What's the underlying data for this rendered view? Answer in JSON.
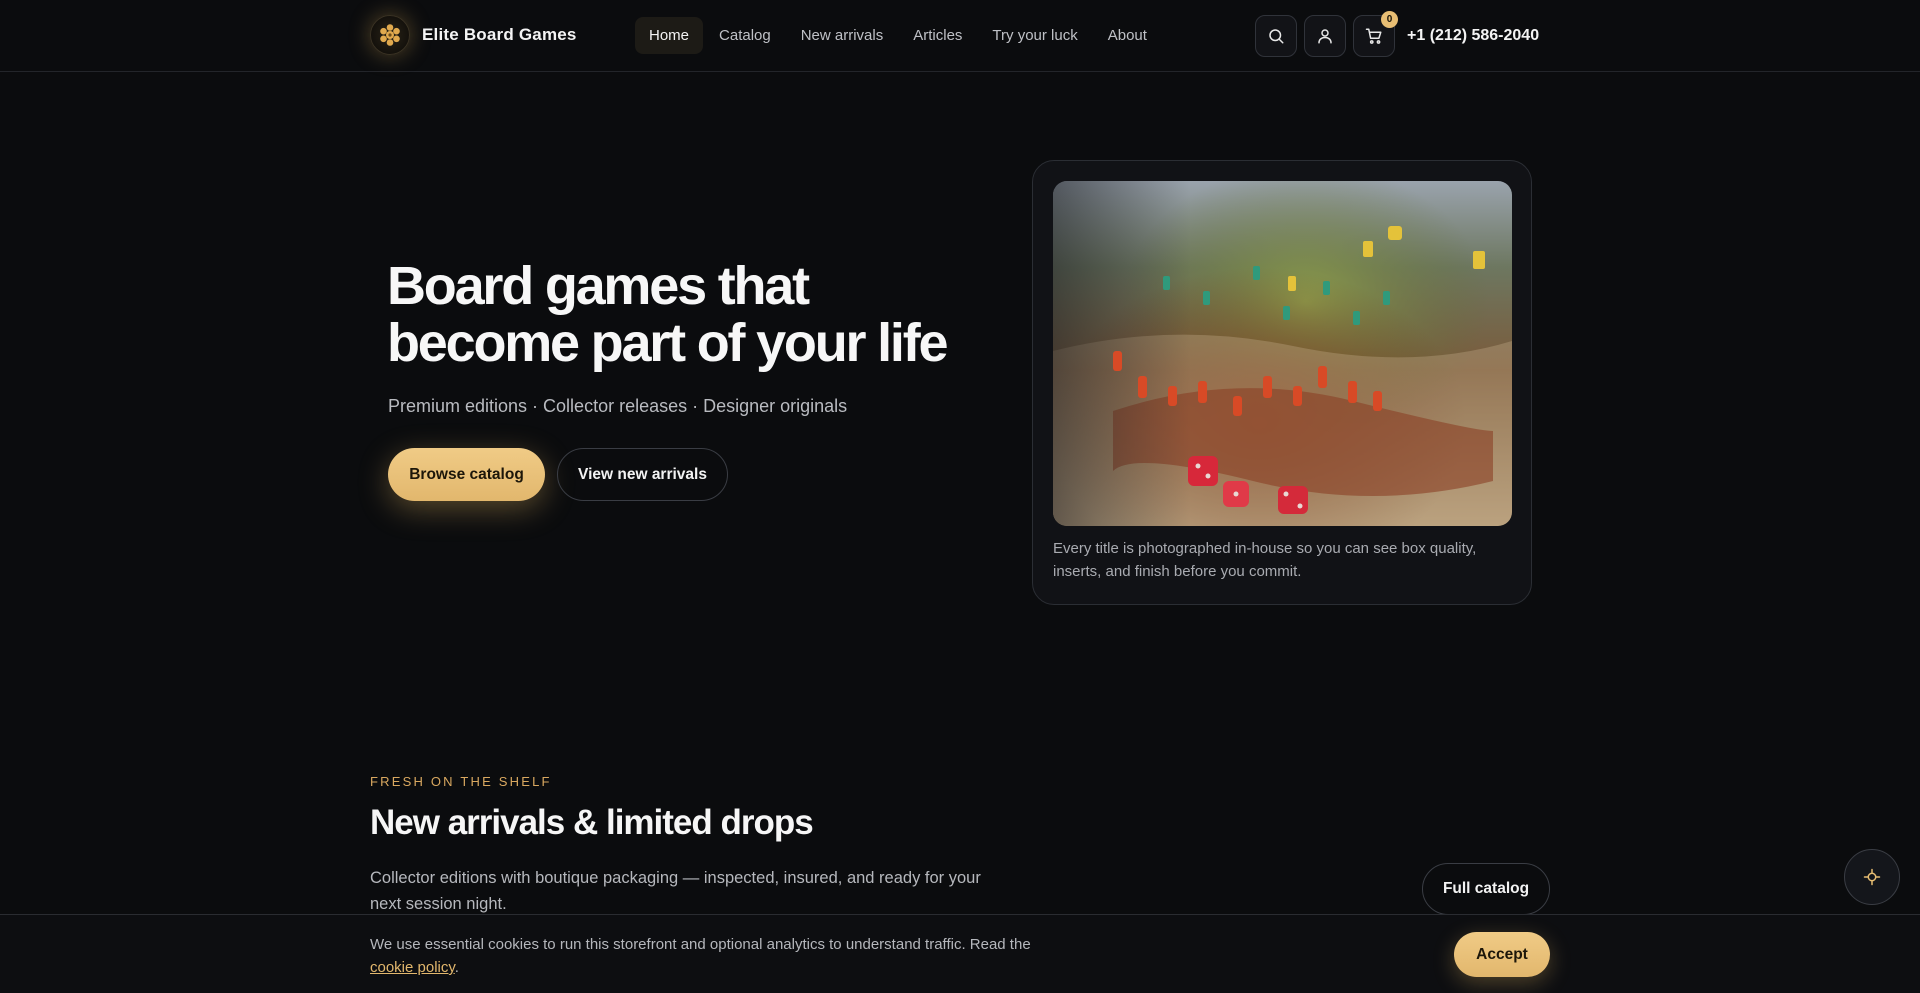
{
  "header": {
    "brand_name": "Elite Board Games",
    "nav": [
      {
        "label": "Home",
        "active": true
      },
      {
        "label": "Catalog"
      },
      {
        "label": "New arrivals"
      },
      {
        "label": "Articles"
      },
      {
        "label": "Try your luck"
      },
      {
        "label": "About"
      }
    ],
    "icons": [
      "search-icon",
      "user-icon",
      "cart-icon"
    ],
    "cart_count": "0",
    "phone": "+1 (212) 586-2040"
  },
  "hero": {
    "title": "Board games that become part of your life",
    "subtitle": "Premium editions · Collector releases · Designer originals",
    "primary_cta": "Browse catalog",
    "secondary_cta": "View new arrivals",
    "caption": "Every title is photographed in-house so you can see box quality, inserts, and finish before you commit."
  },
  "section": {
    "eyebrow": "FRESH ON THE SHELF",
    "title": "New arrivals & limited drops",
    "description": "Collector editions with boutique packaging — inspected, insured, and ready for your next session night.",
    "cta": "Full catalog"
  },
  "cookie": {
    "text": "We use essential cookies to run this storefront and optional analytics to understand traffic. Read the",
    "link": "cookie policy",
    "suffix": ".",
    "accept": "Accept"
  },
  "colors": {
    "accent": "#e8be73",
    "background": "#0b0c0e"
  }
}
